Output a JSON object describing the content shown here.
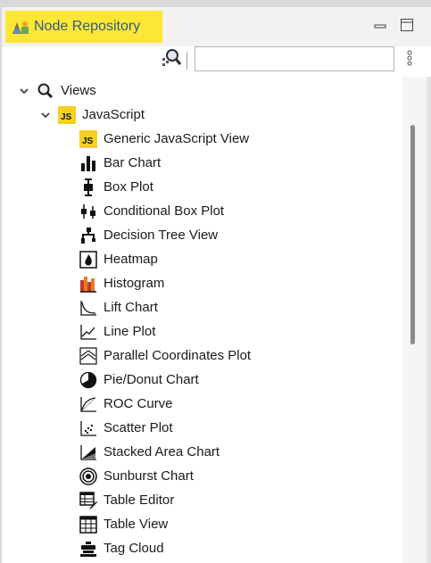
{
  "panel": {
    "title": "Node Repository",
    "minimize_icon": "minimize-icon",
    "maximize_icon": "maximize-icon"
  },
  "search": {
    "value": "",
    "placeholder": "",
    "search_icon": "magnifier-search-icon",
    "more_icon": "vertical-dots-icon"
  },
  "tree": {
    "views": {
      "label": "Views",
      "expanded": true,
      "icon": "magnifier-icon"
    },
    "javascript": {
      "label": "JavaScript",
      "expanded": true,
      "icon": "js-icon"
    },
    "nodes": [
      {
        "label": "Generic JavaScript View",
        "icon": "js-icon"
      },
      {
        "label": "Bar Chart",
        "icon": "bar-chart-icon"
      },
      {
        "label": "Box Plot",
        "icon": "box-plot-icon"
      },
      {
        "label": "Conditional Box Plot",
        "icon": "conditional-box-plot-icon"
      },
      {
        "label": "Decision Tree View",
        "icon": "decision-tree-icon"
      },
      {
        "label": "Heatmap",
        "icon": "heatmap-icon"
      },
      {
        "label": "Histogram",
        "icon": "histogram-icon"
      },
      {
        "label": "Lift Chart",
        "icon": "lift-chart-icon"
      },
      {
        "label": "Line Plot",
        "icon": "line-plot-icon"
      },
      {
        "label": "Parallel Coordinates Plot",
        "icon": "parallel-coordinates-icon"
      },
      {
        "label": "Pie/Donut Chart",
        "icon": "pie-chart-icon"
      },
      {
        "label": "ROC Curve",
        "icon": "roc-curve-icon"
      },
      {
        "label": "Scatter Plot",
        "icon": "scatter-plot-icon"
      },
      {
        "label": "Stacked Area Chart",
        "icon": "stacked-area-icon"
      },
      {
        "label": "Sunburst Chart",
        "icon": "sunburst-icon"
      },
      {
        "label": "Table Editor",
        "icon": "table-editor-icon"
      },
      {
        "label": "Table View",
        "icon": "table-view-icon"
      },
      {
        "label": "Tag Cloud",
        "icon": "tag-cloud-icon"
      }
    ]
  },
  "colors": {
    "tab_highlight": "#fde735",
    "tab_text": "#2f5d8a",
    "js_badge": "#f5d020"
  }
}
